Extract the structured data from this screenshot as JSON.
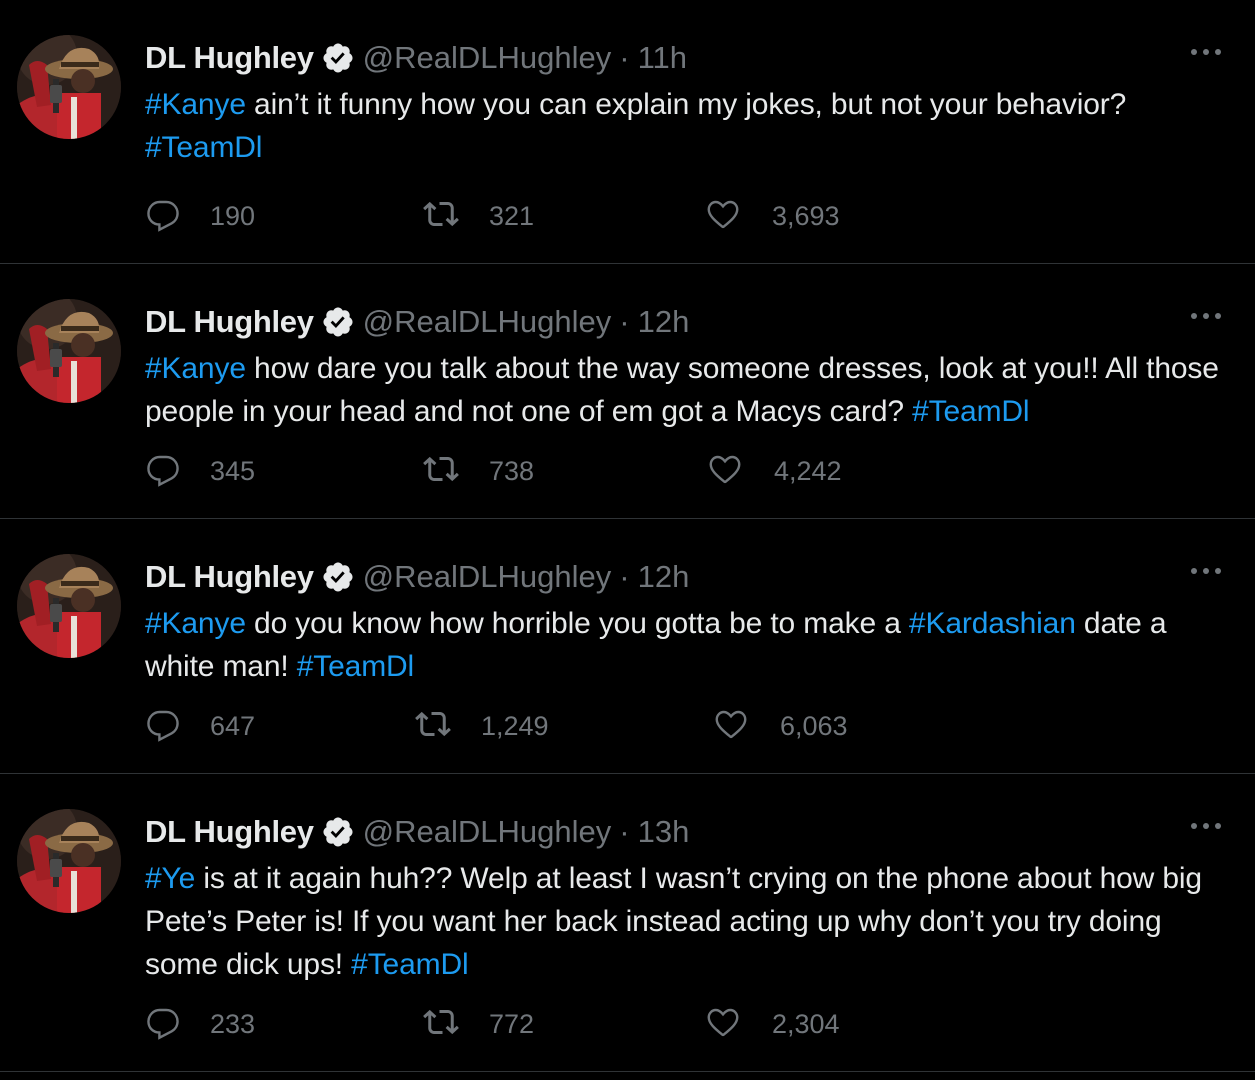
{
  "tweets": [
    {
      "name": "DL Hughley",
      "handle": "@RealDLHughley",
      "dot": "·",
      "time": "11h",
      "text": [
        {
          "t": "#Kanye",
          "h": true
        },
        {
          "t": " ain’t it funny how you can explain my jokes, but not your behavior? ",
          "h": false
        },
        {
          "t": "#TeamDl",
          "h": true
        }
      ],
      "replies": "190",
      "retweets": "321",
      "likes": "3,693"
    },
    {
      "name": "DL Hughley",
      "handle": "@RealDLHughley",
      "dot": "·",
      "time": "12h",
      "text": [
        {
          "t": "#Kanye",
          "h": true
        },
        {
          "t": " how dare you talk about the way someone dresses, look at you!! All those people in your head and not one of em got a Macys card? ",
          "h": false
        },
        {
          "t": "#TeamDl",
          "h": true
        }
      ],
      "replies": "345",
      "retweets": "738",
      "likes": "4,242"
    },
    {
      "name": "DL Hughley",
      "handle": "@RealDLHughley",
      "dot": "·",
      "time": "12h",
      "text": [
        {
          "t": "#Kanye",
          "h": true
        },
        {
          "t": " do you know how horrible you gotta be to make a ",
          "h": false
        },
        {
          "t": "#Kardashian",
          "h": true
        },
        {
          "t": " date a white man! ",
          "h": false
        },
        {
          "t": "#TeamDl",
          "h": true
        }
      ],
      "replies": "647",
      "retweets": "1,249",
      "likes": "6,063"
    },
    {
      "name": "DL Hughley",
      "handle": "@RealDLHughley",
      "dot": "·",
      "time": "13h",
      "text": [
        {
          "t": "#Ye",
          "h": true
        },
        {
          "t": " is at it again huh?? Welp at least I wasn’t crying on the phone about how big Pete’s Peter is! If you want her back instead acting up why don’t you try doing some dick ups! ",
          "h": false
        },
        {
          "t": "#TeamDl",
          "h": true
        }
      ],
      "replies": "233",
      "retweets": "772",
      "likes": "2,304"
    }
  ],
  "icons": {
    "avatar": "avatar-photo",
    "verified": "verified-badge-icon",
    "more": "more-options-icon",
    "reply": "reply-icon",
    "retweet": "retweet-icon",
    "like": "like-icon",
    "share": "share-icon"
  },
  "colors": {
    "background": "#000000",
    "text": "#e7e9ea",
    "secondary": "#71767b",
    "hashtag": "#1d9bf0",
    "divider": "#2f3336"
  }
}
